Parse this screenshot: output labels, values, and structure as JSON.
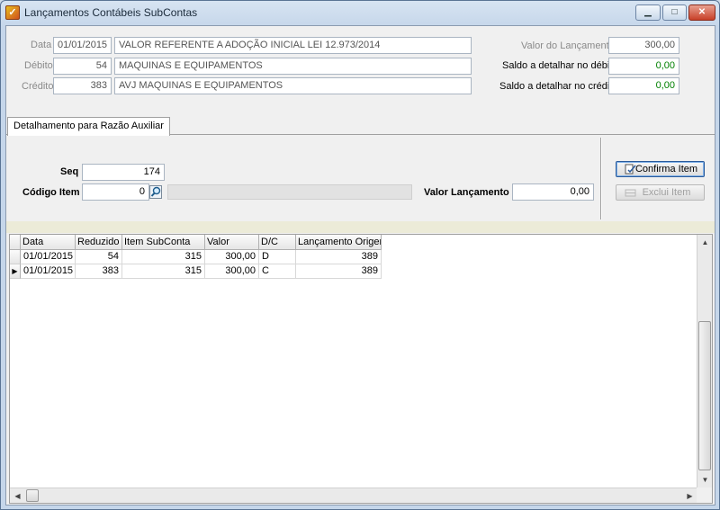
{
  "window": {
    "title": "Lançamentos Contábeis SubContas",
    "app_icon": "checkmark-app-icon",
    "controls": {
      "minimize": "▁",
      "maximize": "□",
      "close": "✕"
    }
  },
  "header": {
    "data_label": "Data",
    "data_value": "01/01/2015",
    "historico": "VALOR REFERENTE A ADOÇÃO INICIAL LEI 12.973/2014",
    "debito_label": "Débito",
    "debito_code": "54",
    "debito_desc": "MAQUINAS E EQUIPAMENTOS",
    "credito_label": "Crédito",
    "credito_code": "383",
    "credito_desc": "AVJ MAQUINAS E EQUIPAMENTOS",
    "valor_lancamento_label": "Valor do Lançamento",
    "valor_lancamento": "300,00",
    "saldo_debito_label": "Saldo a detalhar no débito",
    "saldo_debito": "0,00",
    "saldo_credito_label": "Saldo a detalhar no crédito",
    "saldo_credito": "0,00"
  },
  "tabs": [
    {
      "label": "Detalhamento para Razão Auxiliar"
    }
  ],
  "detail": {
    "seq_label": "Seq",
    "seq_value": "174",
    "codigo_item_label": "Código Item",
    "codigo_item_value": "0",
    "valor_label": "Valor Lançamento",
    "valor_value": "0,00",
    "confirm_button": "Confirma Item",
    "delete_button": "Exclui Item"
  },
  "grid": {
    "columns": [
      "Data",
      "Reduzido",
      "Item SubConta",
      "Valor",
      "D/C",
      "Lançamento Origem"
    ],
    "rows": [
      [
        "01/01/2015",
        "54",
        "315",
        "300,00",
        "D",
        "389"
      ],
      [
        "01/01/2015",
        "383",
        "315",
        "300,00",
        "C",
        "389"
      ]
    ],
    "current_row_marker": "▶"
  },
  "colors": {
    "saldo_green": "#008000",
    "close_red": "#c84028"
  }
}
